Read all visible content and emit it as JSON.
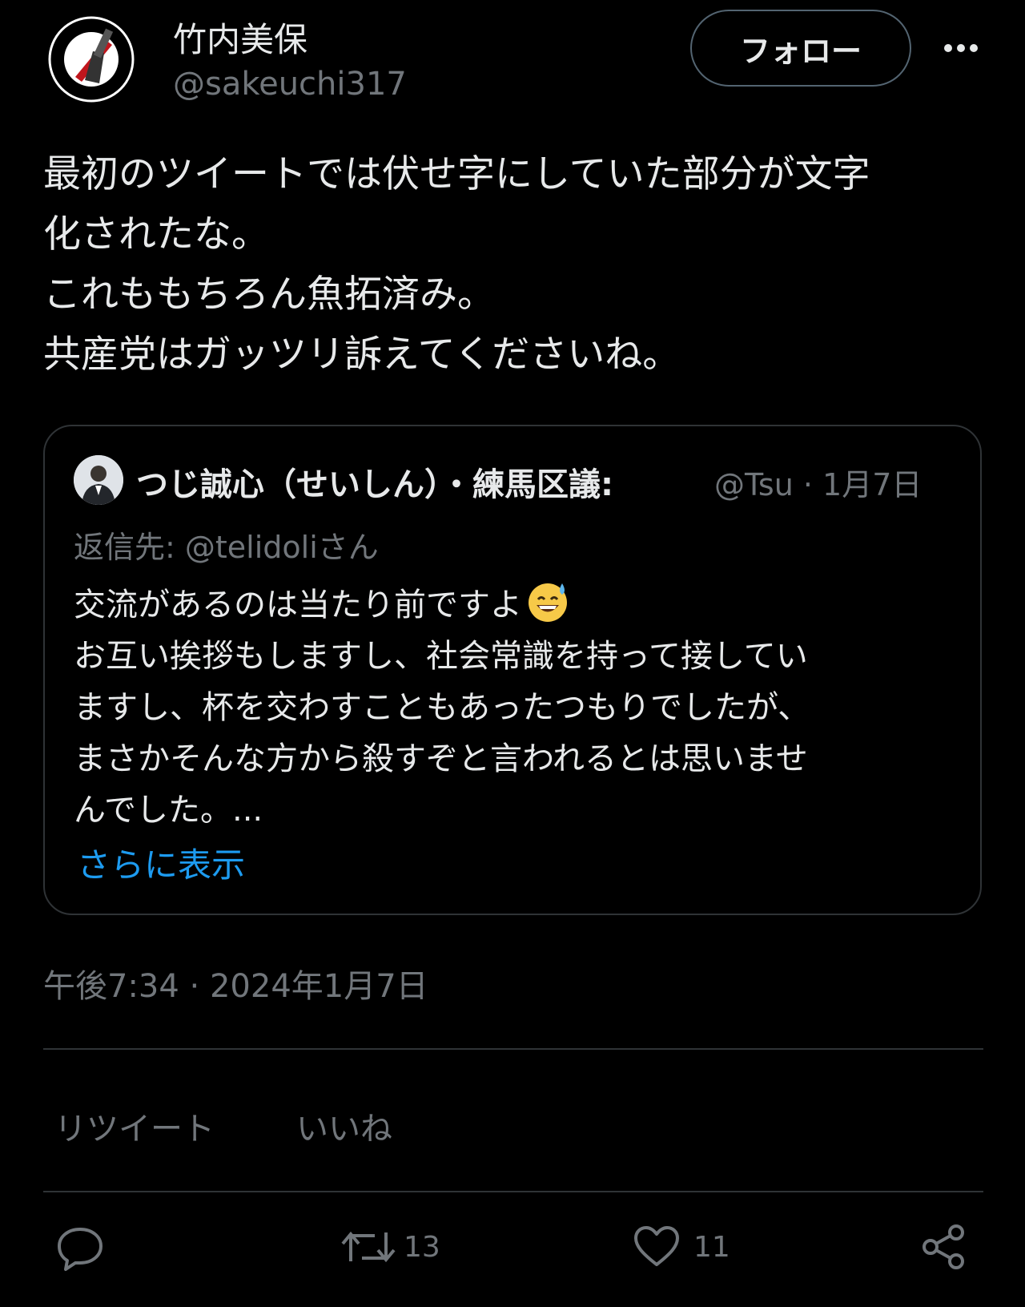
{
  "author": {
    "display_name": "竹内美保",
    "handle": "@sakeuchi317",
    "avatar_icon": "working-class-anti-fascist-logo-icon"
  },
  "header": {
    "follow_label": "フォロー",
    "more_icon": "more-dots-icon"
  },
  "tweet": {
    "lines": [
      "最初のツイートでは伏せ字にしていた部分が文字",
      "化されたな。",
      "これももちろん魚拓済み。",
      "共産党はガッツリ訴えてくださいね。"
    ],
    "timestamp": "午後7:34 · 2024年1月7日"
  },
  "quote": {
    "author_name": "つじ誠心（せいしん）・練馬区議:",
    "author_meta": "@Tsu · 1月7日",
    "reply_to": "返信先: @telidoliさん",
    "lines": [
      "交流があるのは当たり前ですよ",
      "お互い挨拶もしますし、社会常識を持って接してい",
      "ますし、杯を交わすこともあったつもりでしたが、",
      "まさかそんな方から殺すぞと言われるとは思いませ",
      "んでした。..."
    ],
    "emoji": "grinning-sweat-emoji",
    "show_more": "さらに表示"
  },
  "stats": {
    "retweet_label": "リツイート",
    "like_label": "いいね"
  },
  "actions": {
    "reply_icon": "reply-icon",
    "retweet_icon": "retweet-icon",
    "retweet_count": "13",
    "like_icon": "heart-icon",
    "like_count": "11",
    "share_icon": "share-icon"
  },
  "colors": {
    "background": "#000000",
    "text": "#e7e9ea",
    "secondary": "#71767b",
    "link": "#1d9bf0",
    "border": "#2f3336"
  }
}
